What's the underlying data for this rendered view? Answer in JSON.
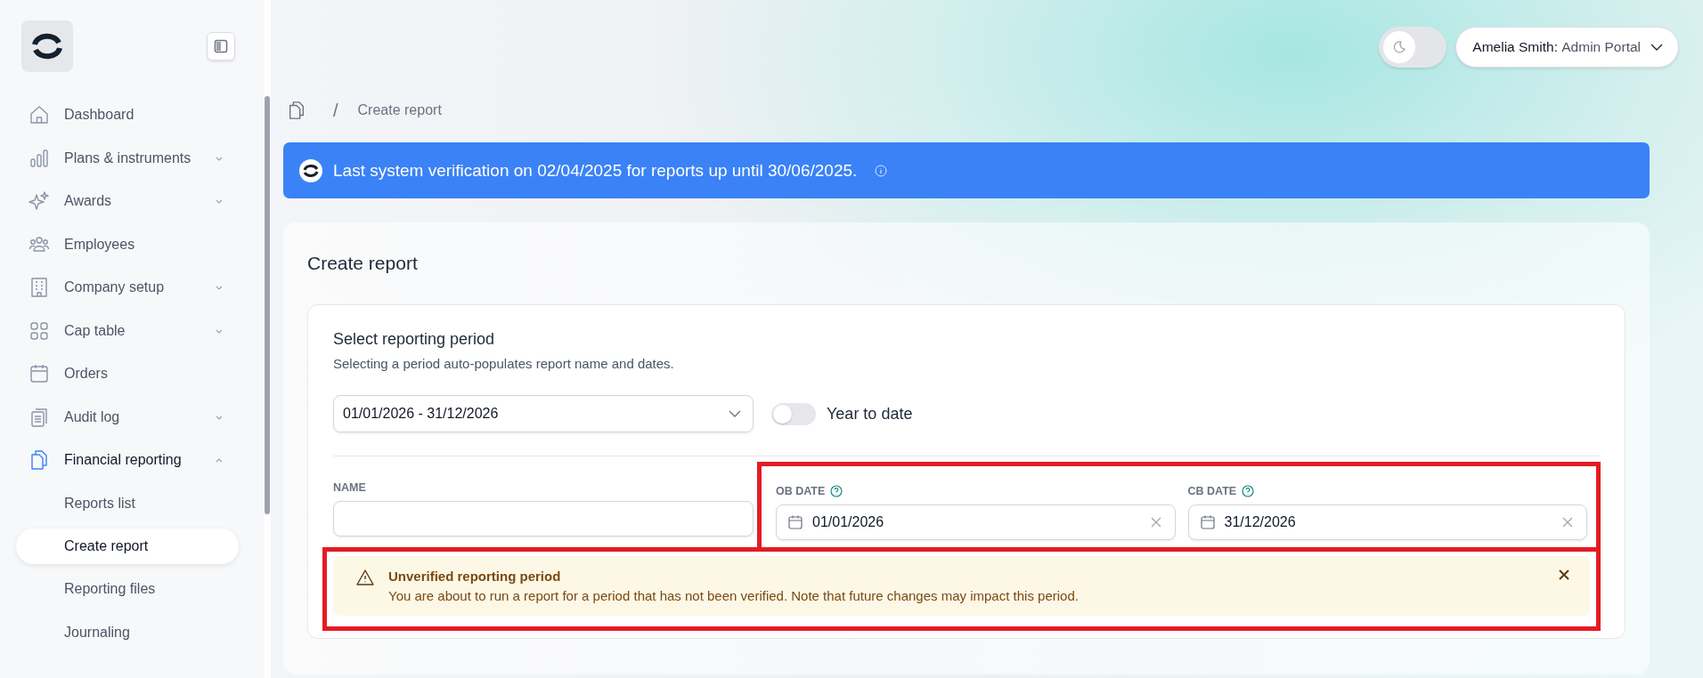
{
  "sidebar": {
    "items": [
      {
        "label": "Dashboard",
        "kind": "home",
        "selected": false
      },
      {
        "label": "Plans & instruments",
        "kind": "bars",
        "expanded": false,
        "selected": false
      },
      {
        "label": "Awards",
        "kind": "sparkles",
        "expanded": false,
        "selected": false
      },
      {
        "label": "Employees",
        "kind": "people",
        "selected": false
      },
      {
        "label": "Company setup",
        "kind": "building",
        "expanded": false,
        "selected": false
      },
      {
        "label": "Cap table",
        "kind": "grid",
        "expanded": false,
        "selected": false
      },
      {
        "label": "Orders",
        "kind": "calendar",
        "selected": false
      },
      {
        "label": "Audit log",
        "kind": "clipboard",
        "expanded": false,
        "selected": false
      },
      {
        "label": "Financial reporting",
        "kind": "files",
        "expanded": true,
        "selected": true,
        "children": [
          {
            "label": "Reports list",
            "selected": false
          },
          {
            "label": "Create report",
            "selected": true
          },
          {
            "label": "Reporting files",
            "selected": false
          },
          {
            "label": "Journaling",
            "selected": false
          }
        ]
      }
    ]
  },
  "header": {
    "dark_mode": false,
    "user_name": "Amelia Smith:",
    "portal": "Admin Portal"
  },
  "breadcrumb": {
    "separator": "/",
    "current": "Create report"
  },
  "banner": {
    "text": "Last system verification on 02/04/2025 for reports up until 30/06/2025."
  },
  "page": {
    "title": "Create report",
    "period": {
      "title": "Select reporting period",
      "subtitle": "Selecting a period auto-populates report name and dates.",
      "value": "01/01/2026 - 31/12/2026",
      "year_to_date": {
        "label": "Year to date",
        "on": false
      }
    },
    "fields": {
      "name": {
        "label": "NAME"
      },
      "highlighted": true,
      "dates": [
        {
          "label": "OB DATE",
          "value": "01/01/2026"
        },
        {
          "label": "CB DATE",
          "value": "31/12/2026"
        }
      ]
    },
    "alert": {
      "title": "Unverified reporting period",
      "text": "You are about to run a report for a period that has not been verified. Note that future changes may impact this period.",
      "highlighted": true
    }
  }
}
